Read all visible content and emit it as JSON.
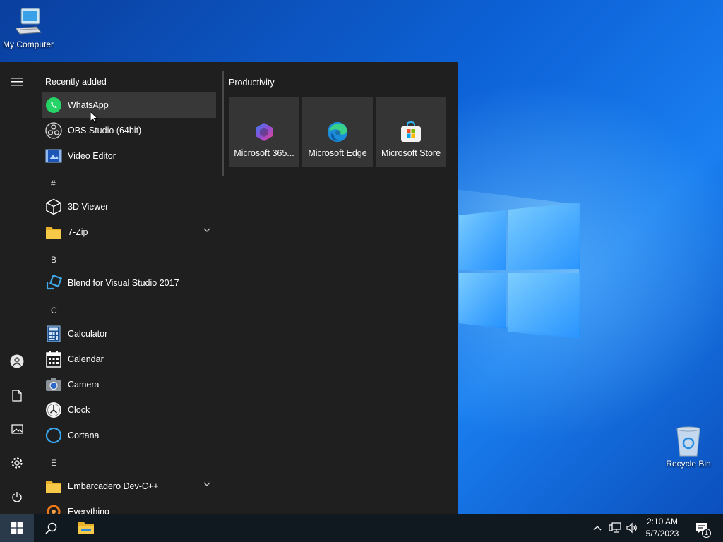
{
  "desktop": {
    "icons": [
      {
        "label": "My Computer",
        "icon": "computer-icon"
      },
      {
        "label": "Recycle Bin",
        "icon": "recycle-bin-icon"
      }
    ]
  },
  "start_menu": {
    "rail": [
      "hamburger-icon",
      "user-icon",
      "documents-icon",
      "pictures-icon",
      "settings-icon",
      "power-icon"
    ],
    "recently_added_title": "Recently added",
    "recent": [
      {
        "label": "WhatsApp",
        "icon": "whatsapp-icon"
      },
      {
        "label": "OBS Studio (64bit)",
        "icon": "obs-icon"
      },
      {
        "label": "Video Editor",
        "icon": "video-editor-icon"
      }
    ],
    "groups": [
      {
        "letter": "#",
        "items": [
          {
            "label": "3D Viewer",
            "icon": "cube-icon"
          },
          {
            "label": "7-Zip",
            "icon": "folder-icon",
            "expandable": true
          }
        ]
      },
      {
        "letter": "B",
        "items": [
          {
            "label": "Blend for Visual Studio 2017",
            "icon": "blend-icon"
          }
        ]
      },
      {
        "letter": "C",
        "items": [
          {
            "label": "Calculator",
            "icon": "calculator-icon"
          },
          {
            "label": "Calendar",
            "icon": "calendar-icon"
          },
          {
            "label": "Camera",
            "icon": "camera-icon"
          },
          {
            "label": "Clock",
            "icon": "clock-icon"
          },
          {
            "label": "Cortana",
            "icon": "cortana-icon"
          }
        ]
      },
      {
        "letter": "E",
        "items": [
          {
            "label": "Embarcadero Dev-C++",
            "icon": "folder-icon",
            "expandable": true
          },
          {
            "label": "Everything",
            "icon": "everything-icon"
          }
        ]
      }
    ],
    "tiles_title": "Productivity",
    "tiles": [
      {
        "label": "Microsoft 365...",
        "icon": "m365-icon"
      },
      {
        "label": "Microsoft Edge",
        "icon": "edge-icon"
      },
      {
        "label": "Microsoft Store",
        "icon": "store-icon"
      }
    ]
  },
  "taskbar": {
    "buttons": [
      "windows-start-icon",
      "search-icon",
      "file-explorer-icon"
    ],
    "tray": {
      "time": "2:10 AM",
      "date": "5/7/2023",
      "notification_count": "1"
    }
  }
}
